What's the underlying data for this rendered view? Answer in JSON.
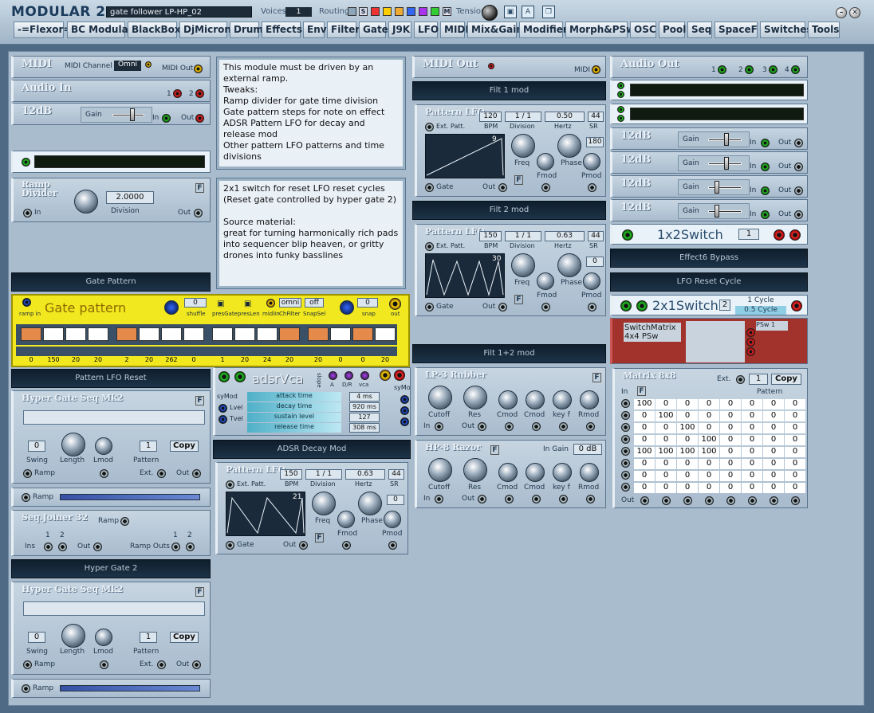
{
  "app": {
    "title": "MODULAR 2",
    "patch_name": "gate follower LP-HP_02",
    "voices_label": "Voices",
    "voices_value": "1",
    "routing_label": "Routing",
    "routing_s": "S",
    "routing_m": "M",
    "tension_label": "Tension",
    "colors": {
      "accent": "#f2e81f",
      "background": "#4e6a85"
    }
  },
  "menu": [
    "-=Flexor=-",
    "BC Modular",
    "BlackBox",
    "DjMicron",
    "Drum",
    "Effects",
    "Env",
    "Filter",
    "Gate",
    "J9K",
    "LFO",
    "MIDI",
    "Mix&Gain",
    "Modifier",
    "Morph&PSw",
    "OSC",
    "Pool",
    "Seq",
    "SpaceF",
    "Switches",
    "Tools"
  ],
  "mods": {
    "midi_in": {
      "title": "MIDI",
      "channel_label": "MIDI Channel",
      "channel_value": "Omni",
      "out_label": "MIDI Out"
    },
    "audio_in": {
      "title": "Audio In",
      "p1": "1",
      "p2": "2"
    },
    "db12_a": {
      "title": "12dB",
      "gain_label": "Gain",
      "in_label": "In",
      "out_label": "Out"
    },
    "ramp_div": {
      "title": "Ramp\nDivider",
      "value": "2.0000",
      "division_label": "Division",
      "in_label": "In",
      "out_label": "Out",
      "f": "F"
    },
    "gate_pattern_bar": "Gate Pattern",
    "gate_pattern": {
      "title": "Gate pattern",
      "ramp_in": "ramp in",
      "shuffle_label": "shuffle",
      "shuffle_value": "0",
      "presgate": "presGate",
      "preslen": "presLen",
      "midiin": "midiIn",
      "chfilter_label": "ChFilter",
      "chfilter_value": "omni",
      "snapsel_label": "SnapSel",
      "snapsel_value": "off",
      "snap_label": "snap",
      "snap_value": "0",
      "out": "out",
      "values": [
        "0",
        "150",
        "20",
        "20",
        "2",
        "20",
        "262",
        "0",
        "1",
        "20",
        "24",
        "20",
        "20",
        "0",
        "0",
        "20"
      ]
    },
    "pattern_lfo_reset_bar": "Pattern LFO Reset",
    "hyper1": {
      "title": "Hyper Gate Seq Mk2",
      "swing_value": "0",
      "swing_label": "Swing",
      "length_label": "Length",
      "lmod_label": "Lmod",
      "pattern_value": "1",
      "pattern_label": "Pattern",
      "copy": "Copy",
      "ramp_label": "Ramp",
      "ext_label": "Ext.",
      "out_label": "Out",
      "f": "F"
    },
    "ramp_strip1": "Ramp",
    "seqjoiner": {
      "title": "Seq.Joiner 32",
      "ramp_label": "Ramp",
      "n1": "1",
      "n2": "2",
      "ins_label": "Ins",
      "out_label": "Out",
      "ramp_outs_label": "Ramp Outs",
      "n3": "1",
      "n4": "2"
    },
    "hyper_gate2_bar": "Hyper Gate 2",
    "hyper2": {
      "title": "Hyper Gate Seq Mk2",
      "swing_value": "0",
      "swing_label": "Swing",
      "length_label": "Length",
      "lmod_label": "Lmod",
      "pattern_value": "1",
      "pattern_label": "Pattern",
      "copy": "Copy",
      "ramp_label": "Ramp",
      "ext_label": "Ext.",
      "out_label": "Out",
      "f": "F"
    },
    "ramp_strip2": "Ramp",
    "note1": "This module must be driven by an external ramp.\nTweaks:\nRamp divider for gate time division\nGate pattern steps for note on effect\nADSR Pattern LFO for decay and release mod\nOther pattern LFO patterns and time divisions",
    "note2": "2x1 switch for reset LFO reset cycles\n(Reset gate controlled by hyper gate 2)\n\nSource material:\ngreat for turning harmonically rich pads into sequencer blip heaven, or gritty drones into funky basslines",
    "adsr": {
      "title": "adsrVca",
      "slope": "slope",
      "a": "A",
      "dr": "D/R",
      "vca": "vca",
      "symod_l": "syMod",
      "lvel": "Lvel",
      "tvel": "Tvel",
      "symod_r": "syMod",
      "attack_label": "attack time",
      "attack": "4 ms",
      "decay_label": "decay time",
      "decay": "920 ms",
      "sustain_label": "sustain level",
      "sustain": "127",
      "release_label": "release time",
      "release": "308 ms"
    },
    "adsr_decay_bar": "ADSR Decay Mod",
    "lfo3": {
      "title": "Pattern LFO",
      "bpm": "150",
      "division": "1 / 1",
      "hertz": "0.63",
      "sr": "44",
      "bpm_label": "BPM",
      "division_label": "Division",
      "hertz_label": "Hertz",
      "sr_label": "SR",
      "ext": "Ext. Patt.",
      "wave_num": "21",
      "phase_val": "0",
      "freq": "Freq",
      "phase": "Phase",
      "fmod": "Fmod",
      "pmod": "Pmod",
      "gate": "Gate",
      "out": "Out",
      "f": "F"
    },
    "midi_out": {
      "title": "MIDI Out",
      "out_label": "MIDI"
    },
    "filt1_bar": "Filt 1 mod",
    "lfo1": {
      "title": "Pattern LFO",
      "bpm": "120",
      "division": "1 / 1",
      "hertz": "0.50",
      "sr": "44",
      "bpm_label": "BPM",
      "division_label": "Division",
      "hertz_label": "Hertz",
      "sr_label": "SR",
      "ext": "Ext. Patt.",
      "wave_num": "9",
      "phase_val": "180",
      "freq": "Freq",
      "phase": "Phase",
      "fmod": "Fmod",
      "pmod": "Pmod",
      "gate": "Gate",
      "out": "Out",
      "f": "F"
    },
    "filt2_bar": "Filt 2 mod",
    "lfo2": {
      "title": "Pattern LFO",
      "bpm": "150",
      "division": "1 / 1",
      "hertz": "0.63",
      "sr": "44",
      "bpm_label": "BPM",
      "division_label": "Division",
      "hertz_label": "Hertz",
      "sr_label": "SR",
      "ext": "Ext. Patt.",
      "wave_num": "30",
      "phase_val": "0",
      "freq": "Freq",
      "phase": "Phase",
      "fmod": "Fmod",
      "pmod": "Pmod",
      "gate": "Gate",
      "out": "Out",
      "f": "F"
    },
    "filt12_bar": "Filt 1+2 mod",
    "lp3": {
      "title": "LP-3 Rubber",
      "cutoff": "Cutoff",
      "res": "Res",
      "cmod1": "Cmod",
      "cmod2": "Cmod",
      "keyf": "key f",
      "rmod": "Rmod",
      "in": "In",
      "out": "Out",
      "f": "F"
    },
    "hp8": {
      "title": "HP-8 Razor",
      "ingain_label": "In Gain",
      "ingain": "0 dB",
      "cutoff": "Cutoff",
      "res": "Res",
      "cmod1": "Cmod",
      "cmod2": "Cmod",
      "keyf": "key f",
      "rmod": "Rmod",
      "in": "In",
      "out": "Out",
      "f": "F"
    },
    "audio_out": {
      "title": "Audio Out",
      "p1": "1",
      "p2": "2",
      "p3": "3",
      "p4": "4"
    },
    "db12": {
      "title": "12dB",
      "gain_label": "Gain",
      "in_label": "In",
      "out_label": "Out"
    },
    "switch1x2": {
      "title": "1x2Switch",
      "value": "1"
    },
    "effect6_bar": "Effect6 Bypass",
    "lfo_reset_bar": "LFO Reset Cycle",
    "switch2x1": {
      "title": "2x1Switch",
      "value": "2",
      "opt1": "1 Cycle",
      "opt2": "0.5 Cycle"
    },
    "switchmatrix": {
      "title": "SwitchMatrix\n4x4 PSw",
      "psw": "PSw 1"
    },
    "matrix": {
      "title": "Matrix 8x8",
      "ext": "Ext.",
      "pattern_value": "1",
      "copy": "Copy",
      "in_label": "In",
      "pattern_label": "Pattern",
      "out_label": "Out",
      "f": "F",
      "rows": [
        [
          "100",
          "0",
          "0",
          "0",
          "0",
          "0",
          "0",
          "0"
        ],
        [
          "0",
          "100",
          "0",
          "0",
          "0",
          "0",
          "0",
          "0"
        ],
        [
          "0",
          "0",
          "100",
          "0",
          "0",
          "0",
          "0",
          "0"
        ],
        [
          "0",
          "0",
          "0",
          "100",
          "0",
          "0",
          "0",
          "0"
        ],
        [
          "100",
          "100",
          "100",
          "100",
          "0",
          "0",
          "0",
          "0"
        ],
        [
          "0",
          "0",
          "0",
          "0",
          "0",
          "0",
          "0",
          "0"
        ],
        [
          "0",
          "0",
          "0",
          "0",
          "0",
          "0",
          "0",
          "0"
        ],
        [
          "0",
          "0",
          "0",
          "0",
          "0",
          "0",
          "0",
          "0"
        ]
      ]
    }
  }
}
